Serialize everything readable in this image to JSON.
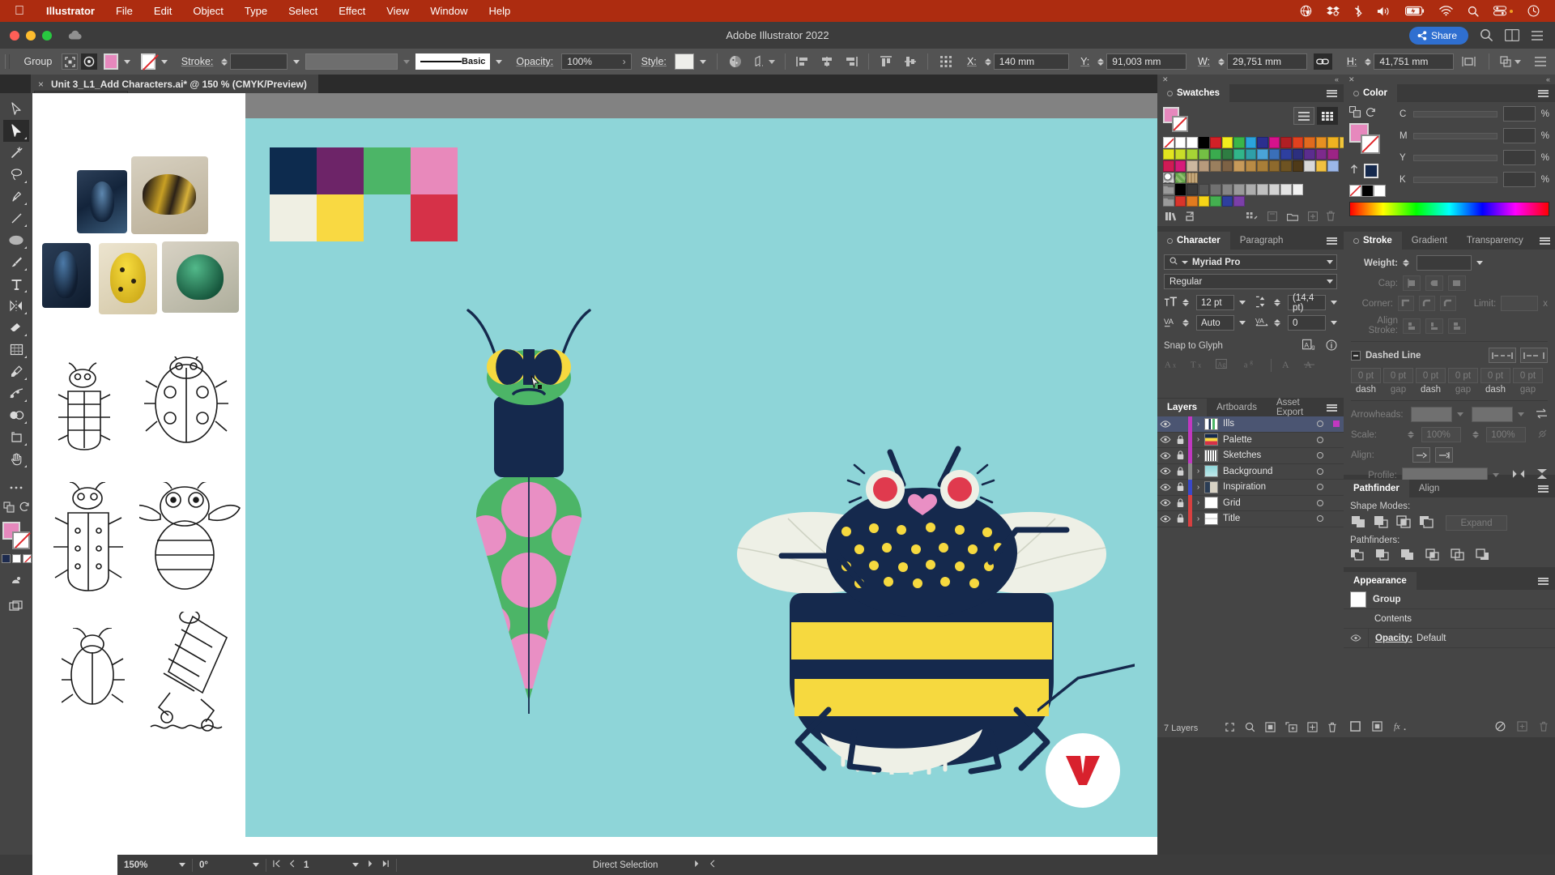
{
  "os_menu": {
    "apple_icon": "apple-icon",
    "items": [
      "Illustrator",
      "File",
      "Edit",
      "Object",
      "Type",
      "Select",
      "Effect",
      "View",
      "Window",
      "Help"
    ],
    "status_icons": [
      "globe-icon",
      "dropbox-icon",
      "bluetooth-icon",
      "volume-icon",
      "battery-charging-icon",
      "wifi-icon",
      "search-icon",
      "control-center-icon",
      "time-machine-icon"
    ]
  },
  "titlebar": {
    "app_title": "Adobe Illustrator 2022",
    "share_label": "Share",
    "icons": [
      "cloud-icon",
      "search-icon",
      "arrange-documents-icon",
      "workspace-switcher-icon"
    ]
  },
  "control_bar": {
    "selection_label": "Group",
    "stroke_label": "Stroke:",
    "stroke_weight": "",
    "profile_label": "Basic",
    "opacity_label": "Opacity:",
    "opacity_value": "100%",
    "style_label": "Style:",
    "x_label": "X:",
    "x_value": "140 mm",
    "y_label": "Y:",
    "y_value": "91,003 mm",
    "w_label": "W:",
    "w_value": "29,751 mm",
    "h_label": "H:",
    "h_value": "41,751 mm",
    "fill_color": "#e688bd",
    "stroke_color": "none"
  },
  "document_tab": {
    "close": "×",
    "title": "Unit 3_L1_Add Characters.ai* @ 150 % (CMYK/Preview)"
  },
  "tools": [
    {
      "name": "selection-tool",
      "selected": false
    },
    {
      "name": "direct-selection-tool",
      "selected": true
    },
    {
      "name": "magic-wand-tool",
      "selected": false
    },
    {
      "name": "lasso-tool",
      "selected": false
    },
    {
      "name": "pen-tool",
      "selected": false
    },
    {
      "name": "line-segment-tool",
      "selected": false
    },
    {
      "name": "ellipse-tool",
      "selected": false
    },
    {
      "name": "paintbrush-tool",
      "selected": false
    },
    {
      "name": "type-tool",
      "selected": false
    },
    {
      "name": "reflect-tool",
      "selected": false
    },
    {
      "name": "eraser-tool",
      "selected": false
    },
    {
      "name": "gradient-mesh-tool",
      "selected": false
    },
    {
      "name": "eyedropper-tool",
      "selected": false
    },
    {
      "name": "blend-tool",
      "selected": false
    },
    {
      "name": "shape-builder-tool",
      "selected": false
    },
    {
      "name": "artboard-tool",
      "selected": false
    },
    {
      "name": "hand-tool",
      "selected": false
    }
  ],
  "floating_panels": [
    {
      "name": "pen-tools-flyout",
      "tools": [
        "add-anchor-point-tool",
        "anchor-point-tool",
        "pen-tool",
        "add-anchor-tool"
      ]
    },
    {
      "name": "transform-tools-flyout",
      "tools": [
        "rotate-tool",
        "scale-tool",
        "reflect-tool",
        "shear-tool"
      ]
    }
  ],
  "panels": {
    "swatches": {
      "tab": "Swatches",
      "view_icons": [
        "list-view-icon",
        "grid-view-icon"
      ],
      "footer_icons": [
        "swatch-libraries-icon",
        "show-libraries-icon",
        "color-group-icon",
        "color-mode-icon",
        "new-color-group-icon",
        "new-swatch-icon",
        "delete-swatch-icon"
      ],
      "row1": [
        "none",
        "#ffffff",
        "#ffffff",
        "#000000",
        "#d32027",
        "#f3ec1d",
        "#3ab54a",
        "#2ba3dc",
        "#2b2f8f",
        "#d7128c",
        "#b01f24",
        "#e1411f",
        "#e06a1e",
        "#e79021",
        "#efb221",
        "#f0c53a"
      ],
      "row2": [
        "#e3e51f",
        "#c9dd28",
        "#a6d435",
        "#74c044",
        "#3aab4e",
        "#2e7d42",
        "#31b58a",
        "#2f9fa8",
        "#4aa3d8",
        "#3a6fb8",
        "#2e3fa0",
        "#2c2f7f",
        "#5b2d8e",
        "#7d2a8c",
        "#9c2485"
      ],
      "row3": [
        "#d01b55",
        "#d61a7a",
        "#cdb79f",
        "#b79a7c",
        "#9a7f5e",
        "#7d6245",
        "#c79a5a",
        "#b98b45",
        "#a97e38",
        "#8e6a2d",
        "#6e5322",
        "#4f3a18",
        "#d8d8d8",
        "#f0c040",
        "#9bb7e8"
      ],
      "row4": [
        "pattern-globe",
        "pattern-green",
        "pattern-texture"
      ],
      "row5_folder": true,
      "row5": [
        "#000000",
        "#3a3a3a",
        "#555555",
        "#707070",
        "#858585",
        "#9a9a9a",
        "#adadad",
        "#c0c0c0",
        "#d2d2d2",
        "#e4e4e4",
        "#f2f2f2"
      ],
      "row6_folder": true,
      "row6": [
        "#d9342b",
        "#e07b1f",
        "#f5d417",
        "#44b050",
        "#2e3f9e",
        "#7b3fa8"
      ]
    },
    "character": {
      "tabs": [
        "Character",
        "Paragraph"
      ],
      "active_tab": "Character",
      "font_family": "Myriad Pro",
      "font_style": "Regular",
      "font_size": "12 pt",
      "leading": "(14,4 pt)",
      "kerning": "Auto",
      "tracking": "0",
      "snap_to_glyph_label": "Snap to Glyph",
      "snap_icons": [
        "glyph-preview-icon",
        "info-icon"
      ],
      "bottom_icons": [
        "touch-type-icon",
        "all-caps-icon",
        "small-caps-icon",
        "superscript-icon",
        "underline-icon",
        "strikethrough-icon"
      ]
    },
    "layers": {
      "tabs": [
        "Layers",
        "Artboards",
        "Asset Export"
      ],
      "active_tab": "Layers",
      "items": [
        {
          "name": "Ills",
          "color": "#c038c0",
          "locked": false,
          "selected": true,
          "targeted": true
        },
        {
          "name": "Palette",
          "color": "#c038c0",
          "locked": true,
          "selected": false,
          "targeted": false
        },
        {
          "name": "Sketches",
          "color": "#c038c0",
          "locked": true,
          "selected": false,
          "targeted": false
        },
        {
          "name": "Background",
          "color": "#8a8a8a",
          "locked": true,
          "selected": false,
          "targeted": false
        },
        {
          "name": "Inspiration",
          "color": "#3a48c8",
          "locked": true,
          "selected": false,
          "targeted": false
        },
        {
          "name": "Grid",
          "color": "#d84040",
          "locked": true,
          "selected": false,
          "targeted": false
        },
        {
          "name": "Title",
          "color": "#d84040",
          "locked": true,
          "selected": false,
          "targeted": false
        }
      ],
      "count_label": "7 Layers",
      "footer_icons": [
        "locate-object-icon",
        "search-icon",
        "make-clipping-mask-icon",
        "create-new-sublayer-icon",
        "create-new-layer-icon",
        "delete-layer-icon"
      ]
    },
    "color": {
      "tab": "Color",
      "mode": "CMYK",
      "channels": [
        {
          "label": "C",
          "value": "",
          "unit": "%"
        },
        {
          "label": "M",
          "value": "",
          "unit": "%"
        },
        {
          "label": "Y",
          "value": "",
          "unit": "%"
        },
        {
          "label": "K",
          "value": "",
          "unit": "%"
        }
      ],
      "fill_color": "#e688bd",
      "stroke_color": "none",
      "quick_swatches": [
        "none",
        "#000000",
        "#ffffff"
      ]
    },
    "stroke": {
      "tabs": [
        "Stroke",
        "Gradient",
        "Transparency"
      ],
      "active_tab": "Stroke",
      "weight_label": "Weight:",
      "weight_value": "",
      "cap_label": "Cap:",
      "corner_label": "Corner:",
      "limit_label": "Limit:",
      "limit_value": "",
      "limit_unit": "x",
      "align_stroke_label": "Align Stroke:",
      "dashed_line_label": "Dashed Line",
      "dash_values": [
        "0 pt",
        "0 pt",
        "0 pt",
        "0 pt",
        "0 pt",
        "0 pt"
      ],
      "dash_labels": [
        "dash",
        "gap",
        "dash",
        "gap",
        "dash",
        "gap"
      ],
      "arrowheads_label": "Arrowheads:",
      "scale_label": "Scale:",
      "scale_values": [
        "100%",
        "100%"
      ],
      "align_label": "Align:",
      "profile_label": "Profile:"
    },
    "pathfinder": {
      "tabs": [
        "Pathfinder",
        "Align"
      ],
      "active_tab": "Pathfinder",
      "shape_modes_label": "Shape Modes:",
      "expand_label": "Expand",
      "pathfinders_label": "Pathfinders:",
      "shape_mode_icons": [
        "unite-icon",
        "minus-front-icon",
        "intersect-icon",
        "exclude-icon"
      ],
      "pathfinder_icons": [
        "divide-icon",
        "trim-icon",
        "merge-icon",
        "crop-icon",
        "outline-icon",
        "minus-back-icon"
      ]
    },
    "appearance": {
      "tab": "Appearance",
      "rows": [
        {
          "label": "Group",
          "indent": 0
        },
        {
          "label": "Contents",
          "indent": 1
        },
        {
          "label": "Opacity:",
          "value": "Default",
          "indent": 1
        }
      ],
      "footer_icons": [
        "add-new-stroke-icon",
        "add-new-fill-icon",
        "add-new-effect-icon",
        "clear-appearance-icon",
        "duplicate-item-icon",
        "delete-item-icon"
      ]
    }
  },
  "status_bar": {
    "zoom": "150%",
    "rotation": "0°",
    "page": "1",
    "tool_name": "Direct Selection",
    "nav_icons": [
      "first-page-icon",
      "prev-page-icon",
      "next-page-icon",
      "last-page-icon"
    ]
  },
  "artwork": {
    "background_color": "#8ed5d8",
    "palette_swatches": [
      {
        "color": "#0d2b4e",
        "name": "navy"
      },
      {
        "color": "#6d2468",
        "name": "purple"
      },
      {
        "color": "#4cb567",
        "name": "green"
      },
      {
        "color": "#e889bb",
        "name": "pink"
      },
      {
        "color": "#efefe3",
        "name": "cream"
      },
      {
        "color": "#f9d942",
        "name": "yellow"
      },
      {
        "color": "#d63148",
        "name": "red"
      }
    ],
    "illustrations": [
      {
        "name": "green-beetle-character",
        "colors": [
          "#4cb567",
          "#e889bb",
          "#0d2b4e",
          "#f9d942"
        ]
      },
      {
        "name": "bee-character",
        "colors": [
          "#15294d",
          "#f9d942",
          "#efefe3",
          "#e03a4e",
          "#e889bb"
        ]
      }
    ],
    "cursor": "direct-selection-cursor"
  }
}
